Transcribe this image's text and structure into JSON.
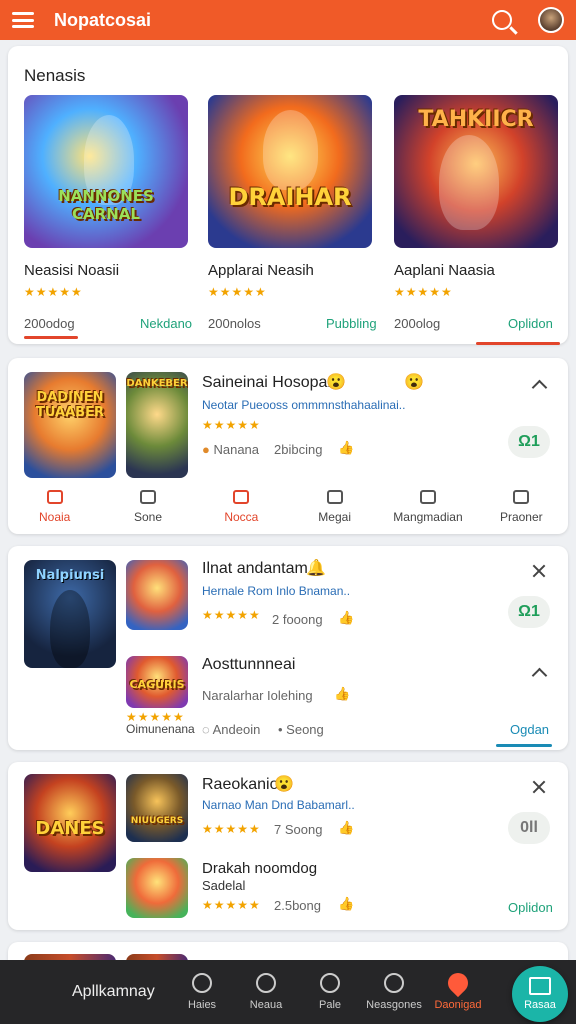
{
  "header": {
    "title": "Nopatcosai"
  },
  "featured": {
    "title": "Nenasis",
    "items": [
      {
        "name": "Neasisi Noasii",
        "stars": "★★★★★",
        "downloads": "200odog",
        "action": "Nekdano",
        "art": "NANNONES CARNAL",
        "accent": "#e2452b"
      },
      {
        "name": "Applarai Neasih",
        "stars": "★★★★★",
        "downloads": "200nolos",
        "action": "Pubbling",
        "art": "DRAIHAR",
        "accent": "#1fa27a"
      },
      {
        "name": "Aaplani Naasia",
        "stars": "★★★★★",
        "downloads": "200olog",
        "action": "Oplidon",
        "art": "TAHKIICR",
        "accent": "#e2452b"
      }
    ]
  },
  "list1": {
    "art_a": "DADINEN TUAABER",
    "art_b": "DANKEBER",
    "title": "Saineinai Hosopar",
    "desc": "Neotar Pueooss ommmnsthahaalinai..",
    "stars": "★★★★★",
    "meta_a": "Nanana",
    "meta_b": "2bibcing",
    "pill": "Ω1",
    "tabs": [
      "Noaia",
      "Sone",
      "Nocca",
      "Megai",
      "Mangmadian",
      "Praoner"
    ]
  },
  "list2": {
    "art_a": "Nalpiunsi",
    "title": "Ilnat andantam",
    "desc": "Hernale Rom Inlo Bnaman..",
    "stars": "★★★★★",
    "meta": "2 fooong",
    "pill": "Ω1",
    "title2": "Aosttunnneai",
    "art_c": "CAGURIS",
    "stars2": "★★★★★",
    "caption": "Oimunenana",
    "meta2": "Naralarhar Iolehing",
    "meta3": "Andeoin",
    "meta4": "Seong",
    "action": "Ogdan"
  },
  "list3": {
    "art_a": "DANES",
    "art_b": "NIUUGERS",
    "title": "Raeokanio",
    "desc": "Narnao Man Dnd Babamarl..",
    "stars": "★★★★★",
    "meta": "7 Soong",
    "pill": "0ll",
    "title2": "Drakah noomdog",
    "sub2": "Sadelal",
    "stars2": "★★★★★",
    "meta2": "2.5bong",
    "action": "Oplidon"
  },
  "bottom_nav": {
    "brand": "Apllkamnay",
    "items": [
      "Haies",
      "Neaua",
      "Pale",
      "Neasgones",
      "Daonigad"
    ],
    "fab": "Rasaa"
  }
}
